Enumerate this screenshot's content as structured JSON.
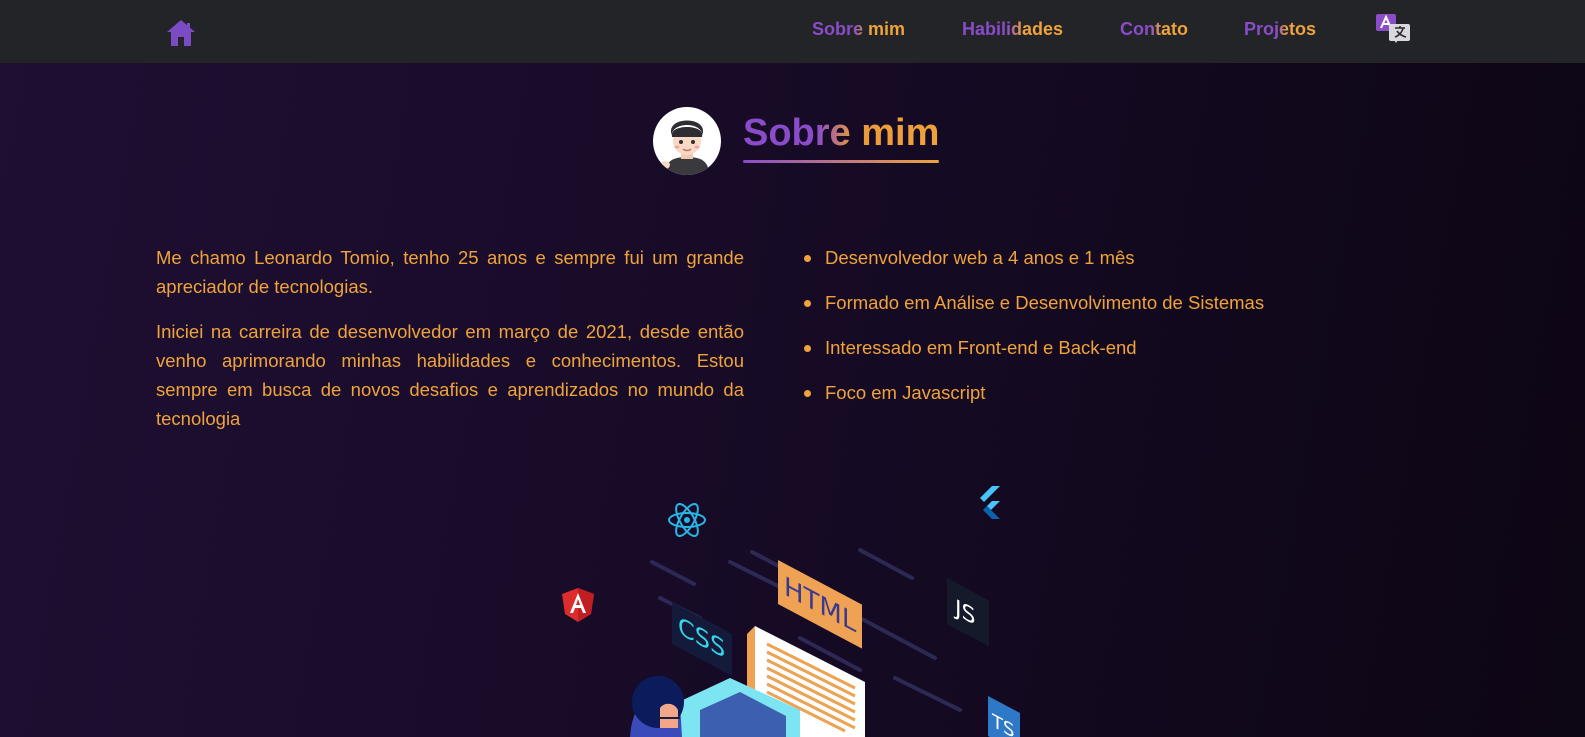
{
  "nav": {
    "home_icon": "home-icon",
    "links": [
      {
        "label": "Sobre mim"
      },
      {
        "label": "Habilidades"
      },
      {
        "label": "Contato"
      },
      {
        "label": "Projetos"
      }
    ],
    "language_icon": "translate-icon"
  },
  "header": {
    "avatar_icon": "avatar-cartoon",
    "title": "Sobre mim"
  },
  "about": {
    "paragraphs": [
      "Me chamo Leonardo Tomio, tenho 25 anos e sempre fui um grande apreciador de tecnologias.",
      "Iniciei na carreira de desenvolvedor em março de 2021, desde então venho aprimorando minhas habilidades e conhecimentos. Estou sempre em busca de novos desafios e aprendizados no mundo da tecnologia"
    ],
    "highlights": [
      "Desenvolvedor web a 4 anos e 1 mês",
      "Formado em Análise e Desenvolvimento de Sistemas",
      "Interessado em Front-end e Back-end",
      "Foco em Javascript"
    ]
  },
  "illustration": {
    "labels": {
      "html": "HTML",
      "css": "CSS",
      "js": "JS",
      "ts": "TS"
    },
    "icons": [
      "react-icon",
      "flutter-icon",
      "angular-icon"
    ]
  },
  "colors": {
    "purple": "#8a4cc9",
    "orange": "#f0a33a",
    "navbar": "#222428",
    "background": "#1f0f33"
  }
}
